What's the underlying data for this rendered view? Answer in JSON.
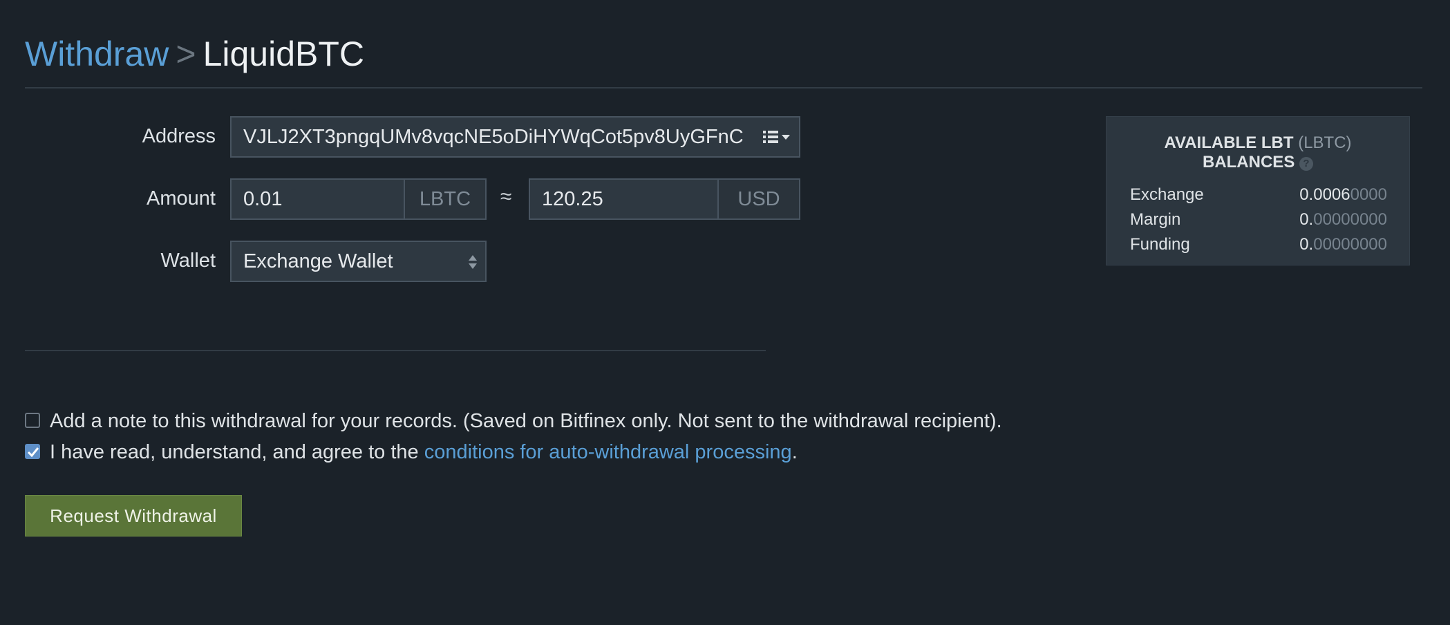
{
  "breadcrumb": {
    "parent": "Withdraw",
    "separator": ">",
    "current": "LiquidBTC"
  },
  "form": {
    "address": {
      "label": "Address",
      "value": "VJLJ2XT3pngqUMv8vqcNE5oDiHYWqCot5pv8UyGFnC",
      "list_icon": "address-book-list-icon"
    },
    "amount": {
      "label": "Amount",
      "value": "0.01",
      "unit": "LBTC",
      "approx_symbol": "≈",
      "converted_value": "120.25",
      "converted_unit": "USD"
    },
    "wallet": {
      "label": "Wallet",
      "selected": "Exchange Wallet"
    }
  },
  "options": {
    "note_checkbox": {
      "checked": false,
      "text": "Add a note to this withdrawal for your records. (Saved on Bitfinex only. Not sent to the withdrawal recipient)."
    },
    "agree_checkbox": {
      "checked": true,
      "text_before": "I have read, understand, and agree to the ",
      "link_text": "conditions for auto-withdrawal processing",
      "text_after": "."
    }
  },
  "submit_label": "Request Withdrawal",
  "balances": {
    "title_main": "AVAILABLE LBT",
    "title_ticker": "(LBTC)",
    "title_line2": "BALANCES",
    "help_icon": "?",
    "rows": [
      {
        "label": "Exchange",
        "value_significant": "0.0006",
        "value_zeros": "0000"
      },
      {
        "label": "Margin",
        "value_significant": "0.",
        "value_zeros": "00000000"
      },
      {
        "label": "Funding",
        "value_significant": "0.",
        "value_zeros": "00000000"
      }
    ]
  },
  "colors": {
    "background": "#1b2229",
    "link": "#5a9fd6",
    "submit_button": "#5a7538",
    "panel": "#2c363f"
  }
}
